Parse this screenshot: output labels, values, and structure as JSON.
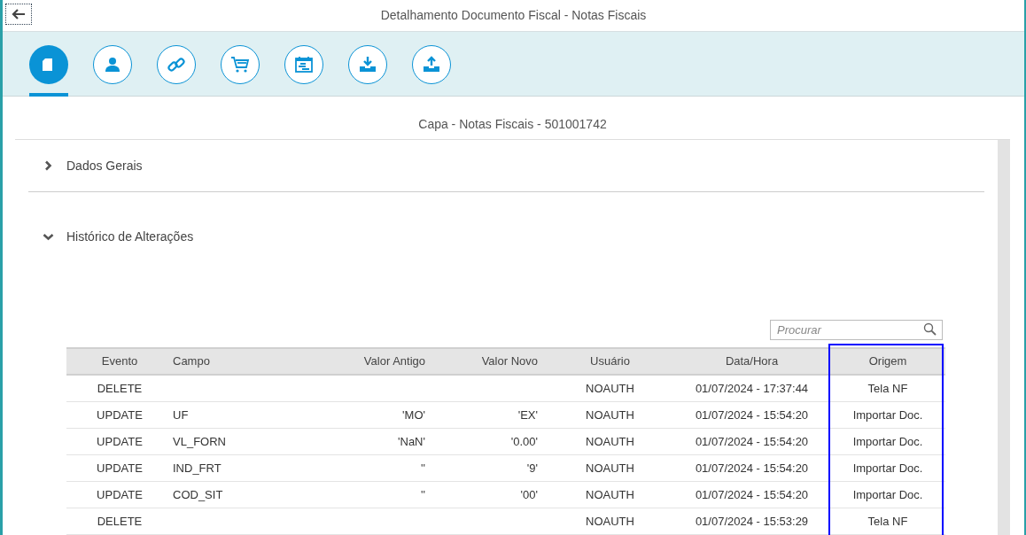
{
  "window": {
    "title": "Detalhamento Documento Fiscal - Notas Fiscais"
  },
  "tabs": [
    {
      "kind": "document",
      "selected": true
    },
    {
      "kind": "person",
      "selected": false
    },
    {
      "kind": "link",
      "selected": false
    },
    {
      "kind": "cart",
      "selected": false
    },
    {
      "kind": "calendar",
      "selected": false
    },
    {
      "kind": "download",
      "selected": false
    },
    {
      "kind": "upload",
      "selected": false
    }
  ],
  "subtitle": "Capa - Notas Fiscais - 501001742",
  "sections": [
    {
      "title": "Dados Gerais",
      "expanded": false
    },
    {
      "title": "Histórico de Alterações",
      "expanded": true
    }
  ],
  "search": {
    "placeholder": "Procurar"
  },
  "table": {
    "columns": [
      {
        "label": "Evento",
        "highlighted": false
      },
      {
        "label": "Campo",
        "highlighted": false
      },
      {
        "label": "Valor Antigo",
        "highlighted": false
      },
      {
        "label": "Valor Novo",
        "highlighted": false
      },
      {
        "label": "Usuário",
        "highlighted": false
      },
      {
        "label": "Data/Hora",
        "highlighted": false
      },
      {
        "label": "Origem",
        "highlighted": true
      }
    ],
    "rows": [
      [
        "DELETE",
        "",
        "",
        "",
        "NOAUTH",
        "01/07/2024 - 17:37:44",
        "Tela NF"
      ],
      [
        "UPDATE",
        "UF",
        "'MO'",
        "'EX'",
        "NOAUTH",
        "01/07/2024 - 15:54:20",
        "Importar Doc."
      ],
      [
        "UPDATE",
        "VL_FORN",
        "'NaN'",
        "'0.00'",
        "NOAUTH",
        "01/07/2024 - 15:54:20",
        "Importar Doc."
      ],
      [
        "UPDATE",
        "IND_FRT",
        "''",
        "'9'",
        "NOAUTH",
        "01/07/2024 - 15:54:20",
        "Importar Doc."
      ],
      [
        "UPDATE",
        "COD_SIT",
        "''",
        "'00'",
        "NOAUTH",
        "01/07/2024 - 15:54:20",
        "Importar Doc."
      ],
      [
        "DELETE",
        "",
        "",
        "",
        "NOAUTH",
        "01/07/2024 - 15:53:29",
        "Tela NF"
      ]
    ]
  }
}
